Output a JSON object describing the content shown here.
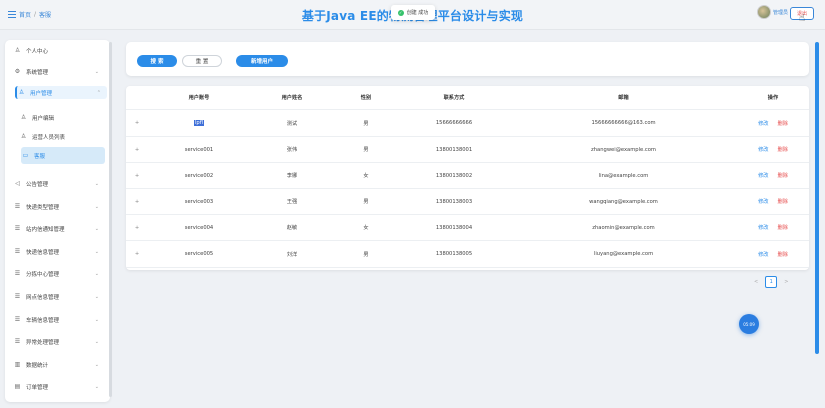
{
  "header": {
    "breadcrumb_home": "首页",
    "breadcrumb_sep": "/",
    "breadcrumb_current": "客服",
    "title": "基于Java EE的物流管理平台设计与实现",
    "toast_text": "创建 成功",
    "user_name": "管理员",
    "logout_label": "退出"
  },
  "sidebar": {
    "items": [
      {
        "label": "个人中心",
        "icon": "user-icon"
      },
      {
        "label": "系统管理",
        "icon": "gear-icon"
      },
      {
        "label": "用户管理",
        "icon": "users-icon"
      },
      {
        "label": "用户编辑",
        "icon": "user-icon"
      },
      {
        "label": "运营人员列表",
        "icon": "user-icon"
      },
      {
        "label": "客服",
        "icon": "chat-icon"
      },
      {
        "label": "公告管理",
        "icon": "megaphone-icon"
      },
      {
        "label": "快递类型管理",
        "icon": "list-icon"
      },
      {
        "label": "站内信通知管理",
        "icon": "list-icon"
      },
      {
        "label": "快递信息管理",
        "icon": "list-icon"
      },
      {
        "label": "分拣中心管理",
        "icon": "list-icon"
      },
      {
        "label": "网点信息管理",
        "icon": "list-icon"
      },
      {
        "label": "车辆信息管理",
        "icon": "list-icon"
      },
      {
        "label": "异常处理管理",
        "icon": "list-icon"
      },
      {
        "label": "数据统计",
        "icon": "chart-icon"
      },
      {
        "label": "订单管理",
        "icon": "order-icon"
      }
    ]
  },
  "toolbar": {
    "search_label": "搜 索",
    "reset_label": "重 置",
    "add_label": "新增用户"
  },
  "table": {
    "columns": [
      "用户账号",
      "用户姓名",
      "性别",
      "联系方式",
      "邮箱",
      "操作"
    ],
    "expand_glyph": "+",
    "edit_label": "修改",
    "delete_label": "删除",
    "rows": [
      {
        "account": "lpfl",
        "name": "测试",
        "gender": "男",
        "phone": "15666666666",
        "email": "15666666666@163.com"
      },
      {
        "account": "service001",
        "name": "张伟",
        "gender": "男",
        "phone": "13800138001",
        "email": "zhangwei@example.com"
      },
      {
        "account": "service002",
        "name": "李娜",
        "gender": "女",
        "phone": "13800138002",
        "email": "lina@example.com"
      },
      {
        "account": "service003",
        "name": "王强",
        "gender": "男",
        "phone": "13800138003",
        "email": "wangqiang@example.com"
      },
      {
        "account": "service004",
        "name": "赵敏",
        "gender": "女",
        "phone": "13800138004",
        "email": "zhaomin@example.com"
      },
      {
        "account": "service005",
        "name": "刘洋",
        "gender": "男",
        "phone": "13800138005",
        "email": "liuyang@example.com"
      }
    ]
  },
  "pager": {
    "prev": "<",
    "current": "1",
    "next": ">"
  },
  "float_button_label": "05:09",
  "colors": {
    "accent": "#2b8ce8",
    "danger": "#e64a4a",
    "success": "#35c26b"
  }
}
